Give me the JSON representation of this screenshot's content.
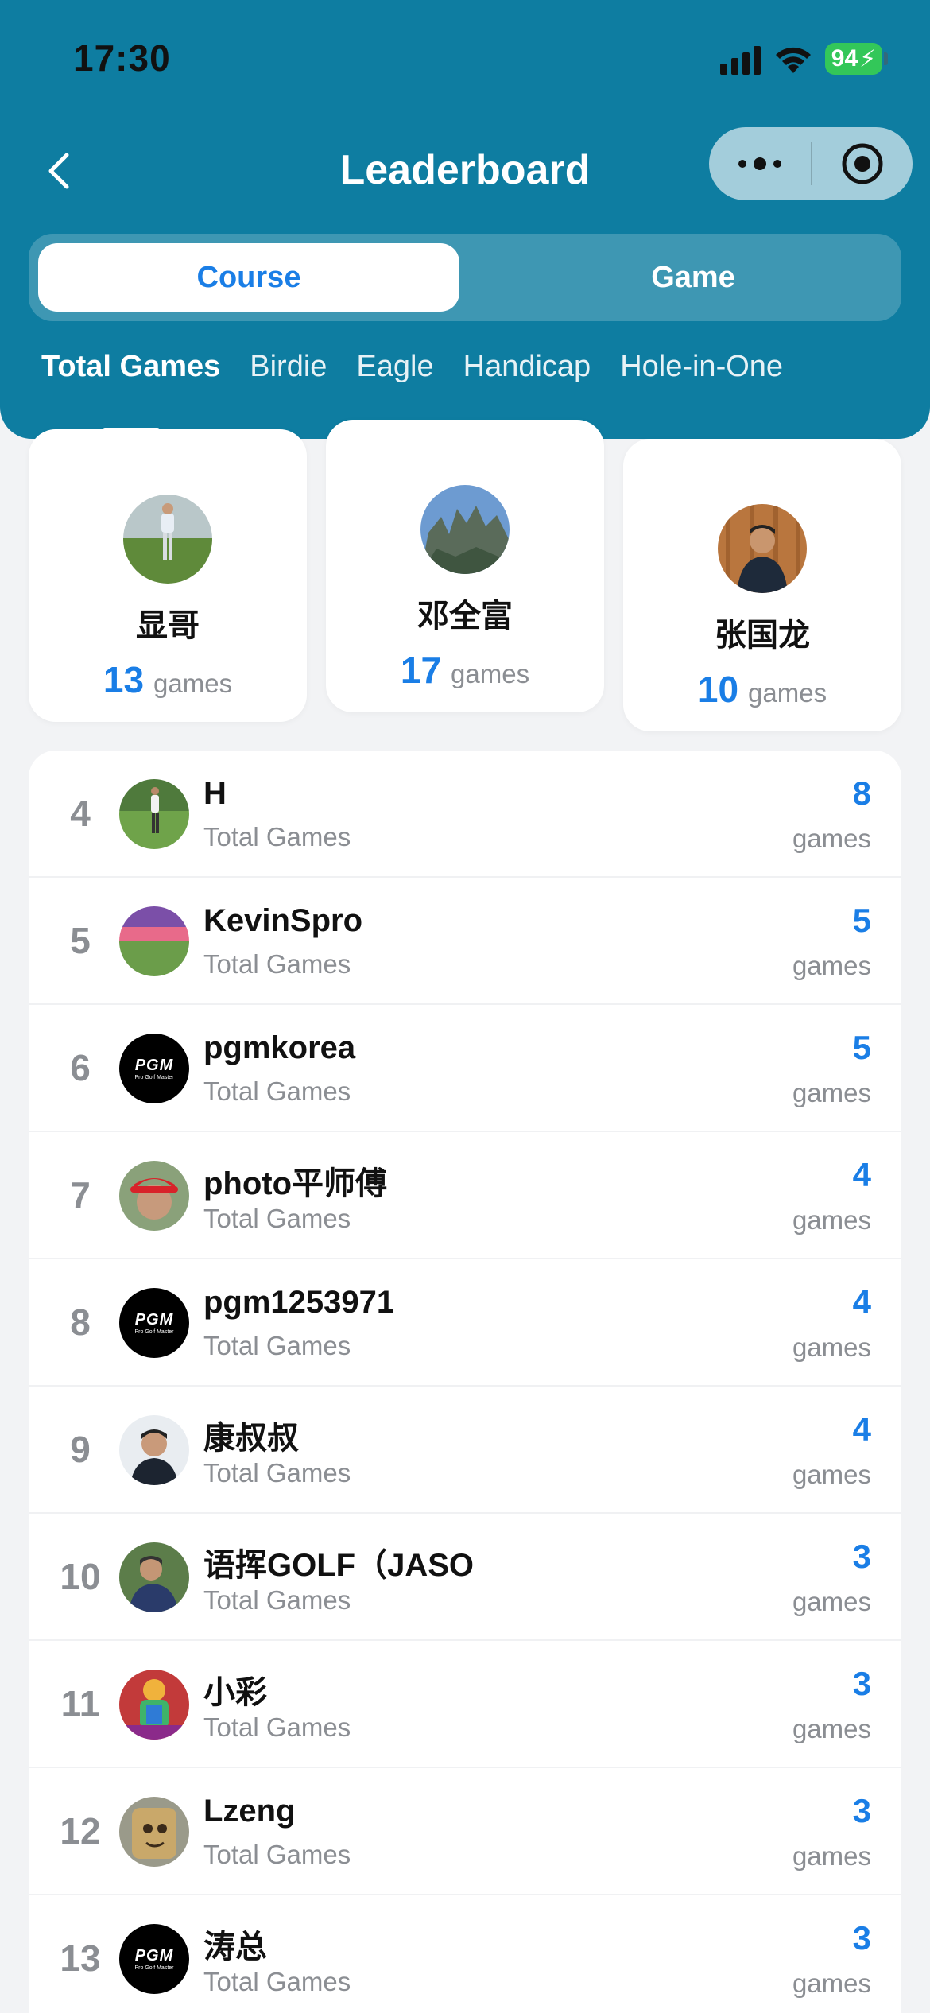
{
  "status": {
    "time": "17:30",
    "battery": "94"
  },
  "nav": {
    "title": "Leaderboard"
  },
  "segment": {
    "course": "Course",
    "game": "Game"
  },
  "tabs": [
    "Total Games",
    "Birdie",
    "Eagle",
    "Handicap",
    "Hole-in-One"
  ],
  "podium": [
    {
      "rank": 2,
      "name": "显哥",
      "count": "13",
      "unit": "games"
    },
    {
      "rank": 1,
      "name": "邓全富",
      "count": "17",
      "unit": "games"
    },
    {
      "rank": 3,
      "name": "张国龙",
      "count": "10",
      "unit": "games"
    }
  ],
  "list": [
    {
      "rank": "4",
      "name": "H",
      "sub": "Total Games",
      "count": "8",
      "unit": "games"
    },
    {
      "rank": "5",
      "name": "KevinSpro",
      "sub": "Total Games",
      "count": "5",
      "unit": "games"
    },
    {
      "rank": "6",
      "name": "pgmkorea",
      "sub": "Total Games",
      "count": "5",
      "unit": "games"
    },
    {
      "rank": "7",
      "name": "photo平师傅",
      "sub": "Total Games",
      "count": "4",
      "unit": "games"
    },
    {
      "rank": "8",
      "name": "pgm1253971",
      "sub": "Total Games",
      "count": "4",
      "unit": "games"
    },
    {
      "rank": "9",
      "name": "康叔叔",
      "sub": "Total Games",
      "count": "4",
      "unit": "games"
    },
    {
      "rank": "10",
      "name": "语挥GOLF（JASO",
      "sub": "Total Games",
      "count": "3",
      "unit": "games"
    },
    {
      "rank": "11",
      "name": "小彩",
      "sub": "Total Games",
      "count": "3",
      "unit": "games"
    },
    {
      "rank": "12",
      "name": "Lzeng",
      "sub": "Total Games",
      "count": "3",
      "unit": "games"
    },
    {
      "rank": "13",
      "name": "涛总",
      "sub": "Total Games",
      "count": "3",
      "unit": "games"
    }
  ],
  "pgm_logo": {
    "main": "PGM",
    "small": "Pro Golf Master"
  },
  "colors": {
    "header": "#0e7da1",
    "accent": "#1a7ee6",
    "muted": "#8b8e93"
  }
}
